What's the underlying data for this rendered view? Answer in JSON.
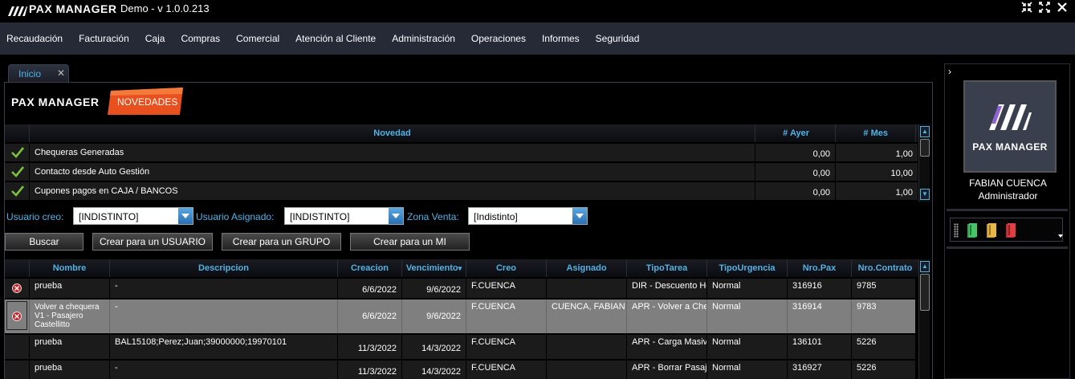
{
  "title_bar": {
    "brand": "PAX MANAGER",
    "version": "Demo - v 1.0.0.213",
    "controls": [
      "minimize-icon",
      "maximize-icon",
      "close-icon"
    ]
  },
  "menu": [
    "Recaudación",
    "Facturación",
    "Caja",
    "Compras",
    "Comercial",
    "Atención al Cliente",
    "Administración",
    "Operaciones",
    "Informes",
    "Seguridad"
  ],
  "tabs": [
    {
      "label": "Inicio",
      "close": "✕"
    }
  ],
  "brand_logo": "PAX MANAGER",
  "novedades_tab": "NOVEDADES",
  "novedades_grid": {
    "headers": [
      "Novedad",
      "# Ayer",
      "# Mes"
    ],
    "rows": [
      {
        "novedad": "Chequeras Generadas",
        "ayer": "0,00",
        "mes": "1,00"
      },
      {
        "novedad": "Contacto desde Auto Gestión",
        "ayer": "0,00",
        "mes": "10,00"
      },
      {
        "novedad": "Cupones pagos en CAJA / BANCOS",
        "ayer": "0,00",
        "mes": "1,00"
      }
    ]
  },
  "filters": {
    "usuario_creo": {
      "label": "Usuario creo:",
      "value": "[INDISTINTO]"
    },
    "usuario_asignado": {
      "label": "Usuario Asignado:",
      "value": "[INDISTINTO]"
    },
    "zona_venta": {
      "label": "Zona Venta:",
      "value": "[Indistinto]"
    }
  },
  "buttons": {
    "buscar": "Buscar",
    "crear_usuario": "Crear para un USUARIO",
    "crear_grupo": "Crear para un GRUPO",
    "crear_mi": "Crear para un MI"
  },
  "tasks_grid": {
    "headers": [
      "Nombre",
      "Descripcion",
      "Creacion",
      "Vencimiento",
      "Creo",
      "Asignado",
      "TipoTarea",
      "TipoUrgencia",
      "Nro.Pax",
      "Nro.Contrato"
    ],
    "sort_indicator": "▾",
    "rows": [
      {
        "icon": "error-icon",
        "nombre": [
          "prueba"
        ],
        "descripcion": "-",
        "creacion": "6/6/2022",
        "vencimiento": "9/6/2022",
        "creo": "F.CUENCA",
        "asignado": "",
        "tipo_tarea": "DIR - Descuento He",
        "tipo_urgencia": "Normal",
        "nro_pax": "316916",
        "nro_contrato": "9785"
      },
      {
        "icon": "error-icon",
        "nombre": [
          "Volver a chequera",
          "V1 - Pasajero",
          "Castellitto"
        ],
        "descripcion": "-",
        "creacion": "6/6/2022",
        "vencimiento": "9/6/2022",
        "creo": "F.CUENCA",
        "asignado": "CUENCA, FABIAN",
        "tipo_tarea": "APR - Volver a Chec",
        "tipo_urgencia": "Normal",
        "nro_pax": "316914",
        "nro_contrato": "9783"
      },
      {
        "icon": "",
        "nombre": [
          "prueba"
        ],
        "descripcion": "BAL15108;Perez;Juan;39000000;19970101",
        "creacion": "11/3/2022",
        "vencimiento": "14/3/2022",
        "creo": "F.CUENCA",
        "asignado": "",
        "tipo_tarea": "APR - Carga Masiva",
        "tipo_urgencia": "Normal",
        "nro_pax": "136101",
        "nro_contrato": "5226"
      },
      {
        "icon": "",
        "nombre": [
          "prueba"
        ],
        "descripcion": "-",
        "creacion": "11/3/2022",
        "vencimiento": "14/3/2022",
        "creo": "F.CUENCA",
        "asignado": "",
        "tipo_tarea": "APR - Borrar Pasaje",
        "tipo_urgencia": "Normal",
        "nro_pax": "316927",
        "nro_contrato": "5226"
      }
    ]
  },
  "sidebar": {
    "toggle": "›",
    "logo_text": "PAX MANAGER",
    "user_name": "FABIAN CUENCA",
    "user_role": "Administrador"
  },
  "colors": {
    "accent": "#4fb3e8",
    "menubar": "#262a37",
    "novedades": "#e8501e",
    "selected_row": "#7f7f7f"
  }
}
